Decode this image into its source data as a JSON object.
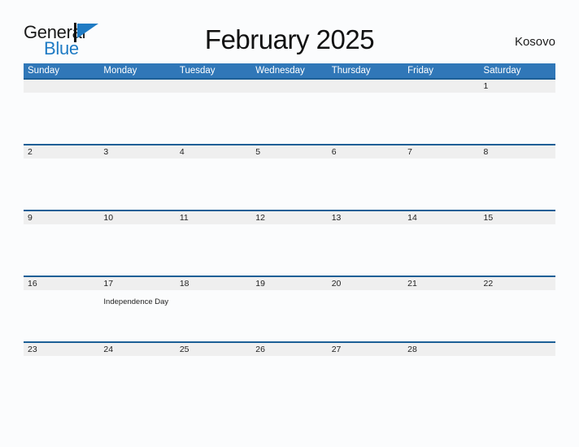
{
  "logo": {
    "word_one": "General",
    "word_two": "Blue",
    "mark": "flag-triangle-icon",
    "accent_color": "#1f7bc4"
  },
  "header": {
    "title": "February 2025",
    "region": "Kosovo"
  },
  "theme": {
    "header_blue": "#3077b8",
    "separator_blue": "#1c5f96",
    "date_band_gray": "#efefef",
    "page_background": "#fbfcfd",
    "text_color": "#1f1f1f"
  },
  "calendar": {
    "weekdays": [
      "Sunday",
      "Monday",
      "Tuesday",
      "Wednesday",
      "Thursday",
      "Friday",
      "Saturday"
    ],
    "weeks": [
      [
        {
          "day": "",
          "event": ""
        },
        {
          "day": "",
          "event": ""
        },
        {
          "day": "",
          "event": ""
        },
        {
          "day": "",
          "event": ""
        },
        {
          "day": "",
          "event": ""
        },
        {
          "day": "",
          "event": ""
        },
        {
          "day": "1",
          "event": ""
        }
      ],
      [
        {
          "day": "2",
          "event": ""
        },
        {
          "day": "3",
          "event": ""
        },
        {
          "day": "4",
          "event": ""
        },
        {
          "day": "5",
          "event": ""
        },
        {
          "day": "6",
          "event": ""
        },
        {
          "day": "7",
          "event": ""
        },
        {
          "day": "8",
          "event": ""
        }
      ],
      [
        {
          "day": "9",
          "event": ""
        },
        {
          "day": "10",
          "event": ""
        },
        {
          "day": "11",
          "event": ""
        },
        {
          "day": "12",
          "event": ""
        },
        {
          "day": "13",
          "event": ""
        },
        {
          "day": "14",
          "event": ""
        },
        {
          "day": "15",
          "event": ""
        }
      ],
      [
        {
          "day": "16",
          "event": ""
        },
        {
          "day": "17",
          "event": "Independence Day"
        },
        {
          "day": "18",
          "event": ""
        },
        {
          "day": "19",
          "event": ""
        },
        {
          "day": "20",
          "event": ""
        },
        {
          "day": "21",
          "event": ""
        },
        {
          "day": "22",
          "event": ""
        }
      ],
      [
        {
          "day": "23",
          "event": ""
        },
        {
          "day": "24",
          "event": ""
        },
        {
          "day": "25",
          "event": ""
        },
        {
          "day": "26",
          "event": ""
        },
        {
          "day": "27",
          "event": ""
        },
        {
          "day": "28",
          "event": ""
        },
        {
          "day": "",
          "event": ""
        }
      ]
    ]
  }
}
